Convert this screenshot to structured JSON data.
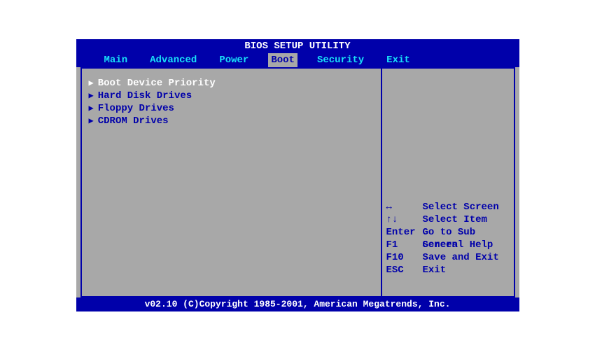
{
  "title": "BIOS SETUP UTILITY",
  "tabs": {
    "main": "Main",
    "advanced": "Advanced",
    "power": "Power",
    "boot": "Boot",
    "security": "Security",
    "exit": "Exit"
  },
  "menu_items": {
    "boot_device_priority": "Boot Device Priority",
    "hard_disk_drives": "Hard Disk Drives",
    "floppy_drives": "Floppy Drives",
    "cdrom_drives": "CDROM Drives"
  },
  "help": {
    "arrows_lr_key": "↔",
    "arrows_lr_desc": "Select Screen",
    "arrows_ud_key": "↑↓",
    "arrows_ud_desc": "Select Item",
    "enter_key": "Enter",
    "enter_desc": "Go to Sub Screen",
    "f1_key": "F1",
    "f1_desc": "General Help",
    "f10_key": "F10",
    "f10_desc": "Save and Exit",
    "esc_key": "ESC",
    "esc_desc": "Exit"
  },
  "footer": "v02.10 (C)Copyright 1985-2001, American Megatrends, Inc."
}
